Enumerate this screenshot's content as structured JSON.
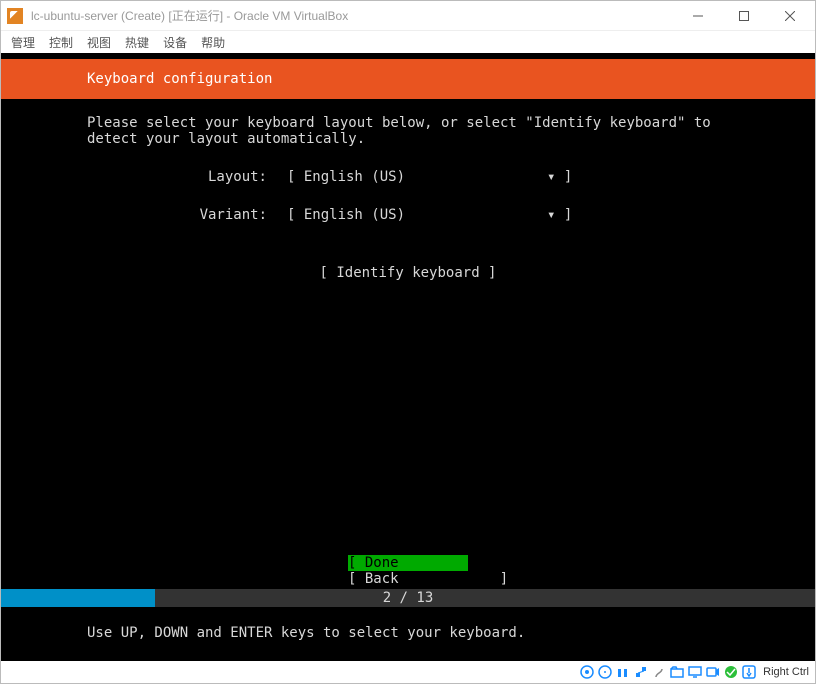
{
  "window": {
    "title": "lc-ubuntu-server (Create) [正在运行] - Oracle VM VirtualBox"
  },
  "menu": {
    "manage": "管理",
    "control": "控制",
    "view": "视图",
    "hotkey": "热键",
    "device": "设备",
    "help": "帮助"
  },
  "installer": {
    "header": "Keyboard configuration",
    "instructions1": "Please select your keyboard layout below, or select \"Identify keyboard\" to",
    "instructions2": "detect your layout automatically.",
    "layout_label": "Layout:",
    "layout_value": "[ English (US)",
    "layout_arrow": "▾ ]",
    "variant_label": "Variant:",
    "variant_value": "[ English (US)",
    "variant_arrow": "▾ ]",
    "identify": "[ Identify keyboard ]",
    "done": "[ Done            ]",
    "back": "[ Back            ]",
    "progress_text": "2 / 13",
    "hint": "Use UP, DOWN and ENTER keys to select your keyboard."
  },
  "statusbar": {
    "host_key": "Right Ctrl"
  }
}
